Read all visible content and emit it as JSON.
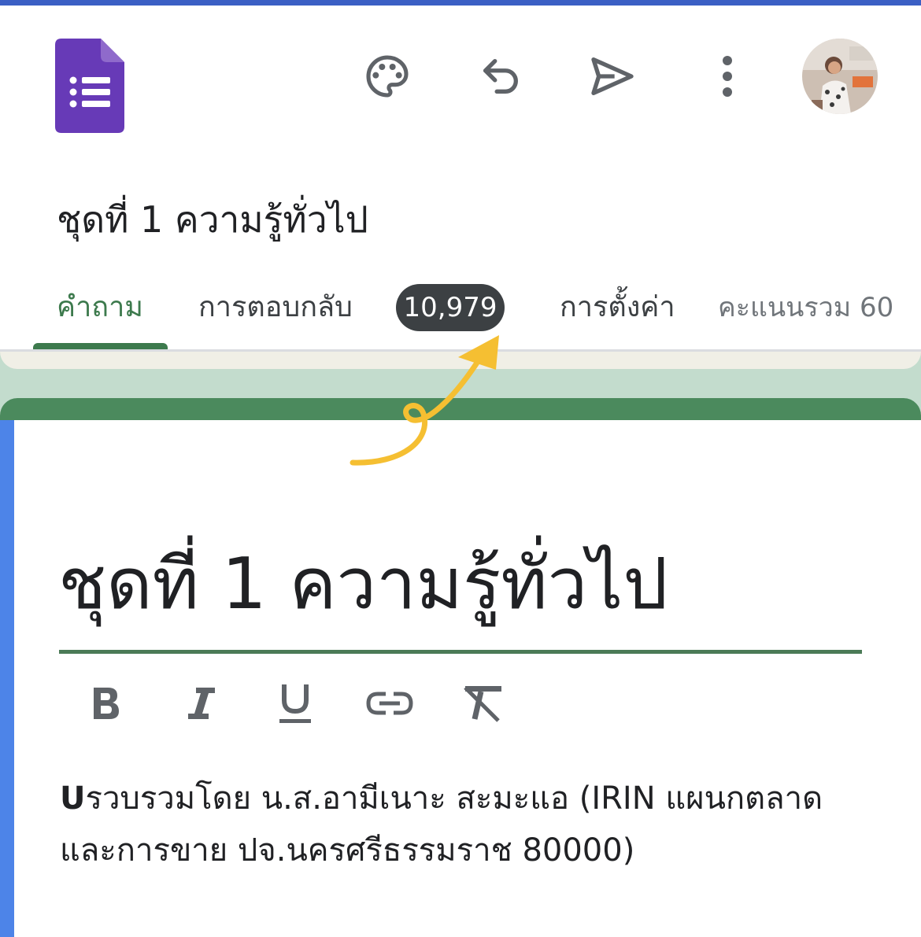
{
  "app": {
    "logo_icon": "google-forms-logo",
    "accent_color": "#3d7a4d",
    "card_accent_color": "#4b8a5d",
    "focus_bar_color": "#4d84e8",
    "background_band_color": "#c3dccd"
  },
  "toolbar": {
    "icons": [
      "palette-icon",
      "undo-icon",
      "send-icon",
      "more-vert-icon"
    ]
  },
  "form": {
    "title": "ชุดที่ 1 ความรู้ทั่วไป"
  },
  "tabs": {
    "questions": "คำถาม",
    "responses": "การตอบกลับ",
    "response_count": "10,979",
    "settings": "การตั้งค่า",
    "total_points": "คะแนนรวม 60"
  },
  "editor": {
    "title": "ชุดที่ 1 ความรู้ทั่วไป",
    "format_buttons": [
      "bold-icon",
      "italic-icon",
      "underline-icon",
      "link-icon",
      "clear-formatting-icon"
    ],
    "description": {
      "bold_prefix": "U",
      "line1": "รวบรวมโดย น.ส.อามีเนาะ  สะมะแอ (IRIN แผนกตลาด",
      "line2": "และการขาย ปจ.นครศรีธรรมราช 80000)"
    }
  },
  "annotation": {
    "arrow_color": "#f5bf32"
  }
}
